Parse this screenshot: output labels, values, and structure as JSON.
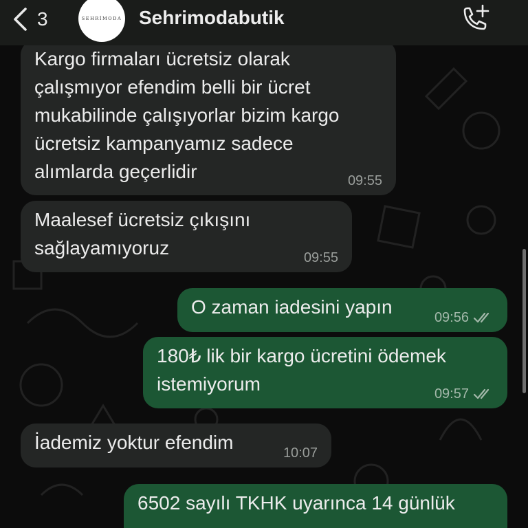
{
  "header": {
    "back_count": "3",
    "avatar_text": "SEHRİMODA",
    "contact_name": "Sehrimodabutik"
  },
  "messages": [
    {
      "direction": "in",
      "text": "Kargo firmaları ücretsiz olarak\nçalışmıyor efendim belli bir ücret\nmukabilinde çalışıyorlar bizim kargo\nücretsiz kampanyamız sadece\nalımlarda geçerlidir",
      "time": "09:55"
    },
    {
      "direction": "in",
      "text": "Maalesef ücretsiz çıkışını\nsağlayamıyoruz",
      "time": "09:55"
    },
    {
      "direction": "out",
      "text": "O zaman iadesini yapın",
      "time": "09:56",
      "status": "read"
    },
    {
      "direction": "out",
      "text": "180₺ lik bir kargo ücretini  ödemek\nistemiyorum",
      "time": "09:57",
      "status": "read"
    },
    {
      "direction": "in",
      "text": "İademiz yoktur efendim",
      "time": "10:07"
    },
    {
      "direction": "out",
      "text": "6502 sayılı TKHK uyarınca 14 günlük",
      "time": ""
    }
  ],
  "colors": {
    "header_bg": "#1a1c1a",
    "incoming_bubble": "#242625",
    "outgoing_bubble": "#1c5734",
    "read_ticks": "#a3b8aa"
  }
}
